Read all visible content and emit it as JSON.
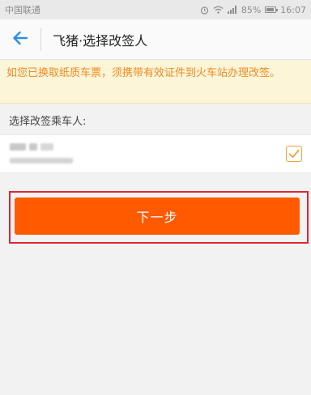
{
  "status_bar": {
    "carrier": "中国联通",
    "battery": "85%",
    "time": "16:07"
  },
  "nav": {
    "title": "飞猪·选择改签人",
    "back_icon": "arrow-left-icon"
  },
  "notice": {
    "text": "如您已换取纸质车票，须携带有效证件到火车站办理改签。"
  },
  "passenger_section": {
    "label": "选择改签乘车人:"
  },
  "next_button": {
    "label": "下一步"
  },
  "colors": {
    "accent": "#ff5a00",
    "notice_text": "#f08a24",
    "checkbox": "#f0a236",
    "highlight": "#e0242f",
    "back_arrow": "#2b8fe6"
  }
}
